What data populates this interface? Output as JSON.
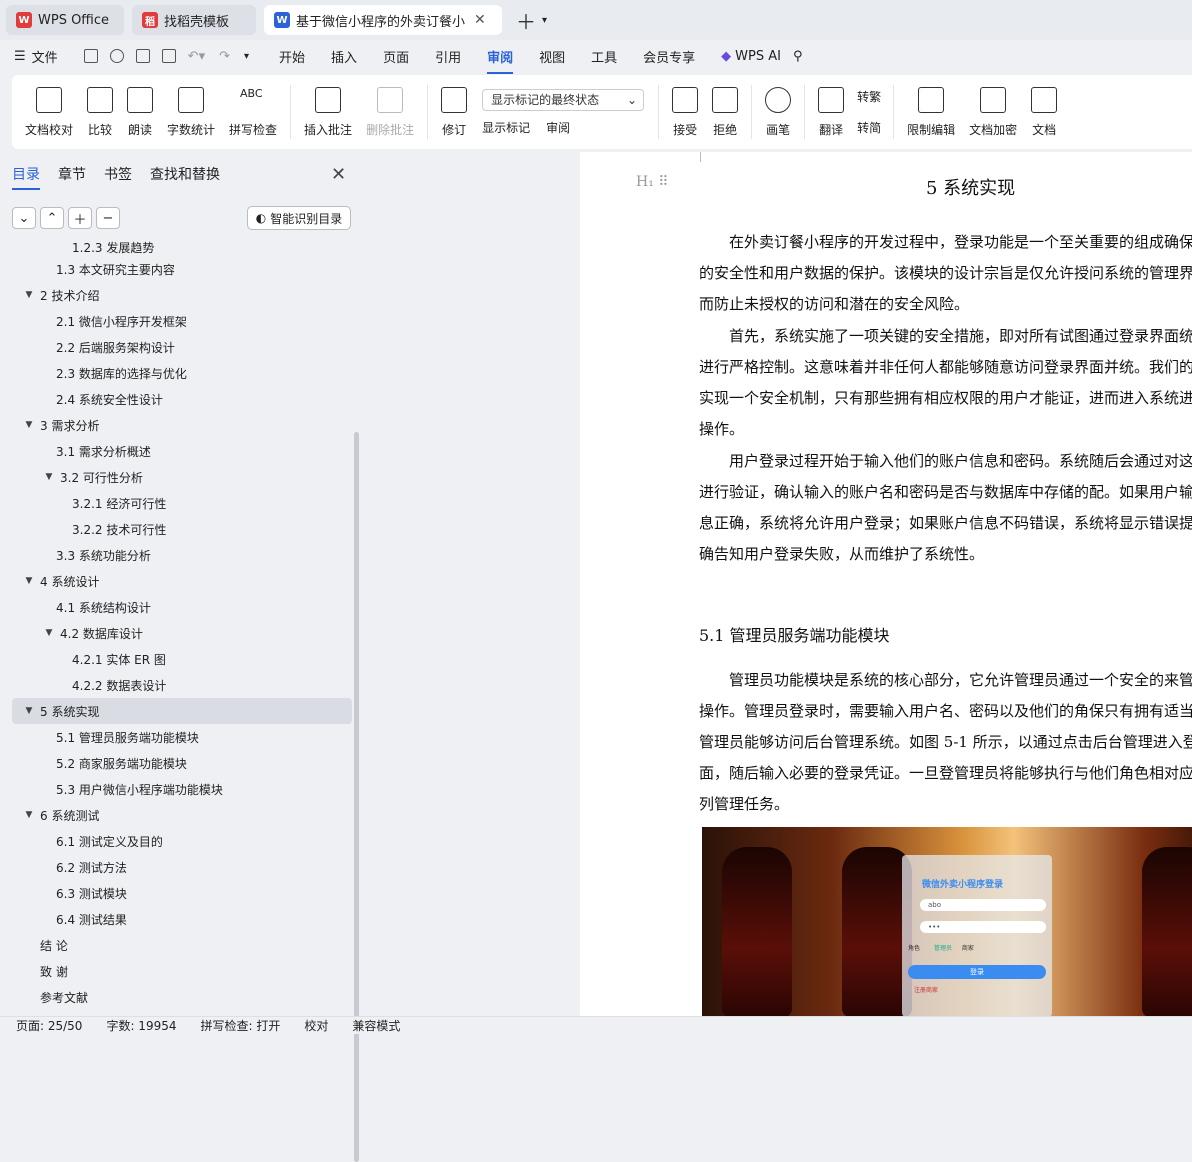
{
  "tabs": [
    {
      "label": "WPS Office"
    },
    {
      "label": "找稻壳模板"
    },
    {
      "label": "基于微信小程序的外卖订餐小"
    }
  ],
  "menu": {
    "file": "文件",
    "items": [
      "开始",
      "插入",
      "页面",
      "引用",
      "审阅",
      "视图",
      "工具",
      "会员专享"
    ],
    "ai": "WPS AI"
  },
  "ribbon": {
    "proofread": "文档校对",
    "compare": "比较",
    "read_aloud": "朗读",
    "word_count": "字数统计",
    "spell_check": "拼写检查",
    "insert_comment": "插入批注",
    "delete_comment": "删除批注",
    "revise": "修订",
    "markup_state": "显示标记的最终状态",
    "show_markup": "显示标记",
    "review": "审阅",
    "accept": "接受",
    "reject": "拒绝",
    "ink": "画笔",
    "translate": "翻译",
    "to_trad": "转繁",
    "to_simp": "转简",
    "restrict": "限制编辑",
    "encrypt": "文档加密",
    "more": "文档"
  },
  "panel": {
    "tabs": [
      "目录",
      "章节",
      "书签",
      "查找和替换"
    ],
    "smart": "智能识别目录"
  },
  "toc": [
    {
      "label": "1.2.3 发展趋势"
    },
    {
      "label": "1.3 本文研究主要内容"
    },
    {
      "label": "2 技术介绍"
    },
    {
      "label": "2.1 微信小程序开发框架"
    },
    {
      "label": "2.2 后端服务架构设计"
    },
    {
      "label": "2.3 数据库的选择与优化"
    },
    {
      "label": "2.4 系统安全性设计"
    },
    {
      "label": "3 需求分析"
    },
    {
      "label": "3.1 需求分析概述"
    },
    {
      "label": "3.2 可行性分析"
    },
    {
      "label": "3.2.1 经济可行性"
    },
    {
      "label": "3.2.2 技术可行性"
    },
    {
      "label": "3.3 系统功能分析"
    },
    {
      "label": "4 系统设计"
    },
    {
      "label": "4.1 系统结构设计"
    },
    {
      "label": "4.2 数据库设计"
    },
    {
      "label": "4.2.1 实体 ER 图"
    },
    {
      "label": "4.2.2 数据表设计"
    },
    {
      "label": "5 系统实现"
    },
    {
      "label": "5.1 管理员服务端功能模块"
    },
    {
      "label": "5.2 商家服务端功能模块"
    },
    {
      "label": "5.3 用户微信小程序端功能模块"
    },
    {
      "label": "6 系统测试"
    },
    {
      "label": "6.1 测试定义及目的"
    },
    {
      "label": "6.2 测试方法"
    },
    {
      "label": "6.3 测试模块"
    },
    {
      "label": "6.4 测试结果"
    },
    {
      "label": "结 论"
    },
    {
      "label": "致 谢"
    },
    {
      "label": "参考文献"
    }
  ],
  "doc": {
    "chapter": "5 系统实现",
    "p1": "在外卖订餐小程序的开发过程中，登录功能是一个至关重要的组成确保了系统的安全性和用户数据的保护。该模块的设计宗旨是仅允许授问系统的管理界面，从而防止未授权的访问和潜在的安全风险。",
    "p2": "首先，系统实施了一项关键的安全措施，即对所有试图通过登录界面统的行为进行严格控制。这意味着并非任何人都能够随意访问登录界面并统。我们的目标是实现一个安全机制，只有那些拥有相应权限的用户才能证，进而进入系统进行管理操作。",
    "p3": "用户登录过程开始于输入他们的账户信息和密码。系统随后会通过对这些凭据进行验证，确认输入的账户名和密码是否与数据库中存储的配。如果用户输入的信息正确，系统将允许用户登录；如果账户信息不码错误，系统将显示错误提示，明确告知用户登录失败，从而维护了系统性。",
    "section": "5.1 管理员服务端功能模块",
    "p4": "管理员功能模块是系统的核心部分，它允许管理员通过一个安全的来管理后台操作。管理员登录时，需要输入用户名、密码以及他们的角保只有拥有适当权限的管理员能够访问后台管理系统。如图 5-1 所示，以通过点击后台管理进入登录页面，随后输入必要的登录凭证。一旦登管理员将能够执行与他们角色相对应的一系列管理任务。",
    "login_title": "微信外卖小程序登录",
    "login_user": "abo",
    "login_pass": "•••",
    "login_role": "角色",
    "role_admin": "管理员",
    "role_shop": "商家",
    "login_btn": "登录",
    "register": "注册商家"
  },
  "status": {
    "page": "页面: 25/50",
    "words": "字数: 19954",
    "spell": "拼写检查: 打开",
    "proof": "校对",
    "compat": "兼容模式"
  }
}
